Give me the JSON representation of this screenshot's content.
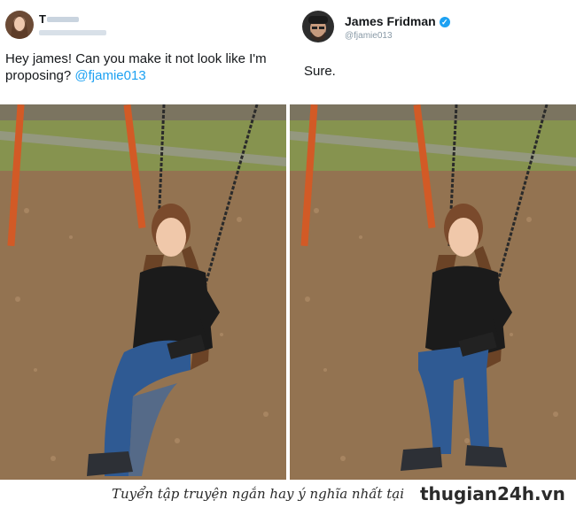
{
  "left_tweet": {
    "author_name": "T",
    "tweet_text": "Hey james! Can you make it not look like I'm proposing?",
    "mention": "@fjamie013"
  },
  "right_tweet": {
    "author_name": "James Fridman",
    "verified_icon": "verified-badge-icon",
    "handle": "@fjamie013",
    "tweet_text": "Sure."
  },
  "footer": {
    "caption": "Tuyển tập truyện ngắn hay ý nghĩa nhất tại",
    "site": "thugian24h.vn"
  },
  "colors": {
    "link": "#1da1f2",
    "text": "#14171a",
    "muted": "#8899a6",
    "swing_post": "#d25a26"
  }
}
